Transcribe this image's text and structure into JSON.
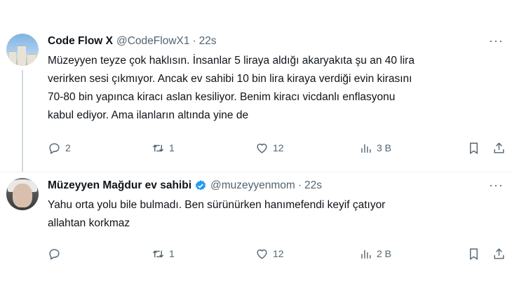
{
  "tweets": [
    {
      "name": "Code Flow X",
      "handle": "@CodeFlowX1",
      "separator": "·",
      "time": "22s",
      "more": "···",
      "body_lines": [
        "Müzeyyen teyze çok haklısın. İnsanlar 5 liraya aldığı akaryakıta şu an 40 lira",
        "verirken sesi çıkmıyor. Ancak ev sahibi 10 bin lira kiraya verdiği evin kirasını",
        "70-80 bin yapınca kiracı aslan kesiliyor.  Benim kiracı vicdanlı enflasyonu",
        "kabul ediyor. Ama ilanların altında yine de"
      ],
      "reply_count": "2",
      "retweet_count": "1",
      "like_count": "12",
      "view_count": "3 B",
      "verified": false
    },
    {
      "name": "Müzeyyen Mağdur ev sahibi",
      "handle": "@muzeyyenmom",
      "separator": "·",
      "time": "22s",
      "more": "···",
      "body_lines": [
        "Yahu orta yolu bile bulmadı. Ben sürünürken hanımefendi keyif çatıyor",
        "allahtan korkmaz"
      ],
      "reply_count": "",
      "retweet_count": "1",
      "like_count": "12",
      "view_count": "2 B",
      "verified": true
    }
  ],
  "colors": {
    "text": "#0f1419",
    "secondary": "#536471",
    "verified": "#1d9bf0",
    "divider": "#eff3f4"
  },
  "icons": [
    "reply-icon",
    "retweet-icon",
    "like-icon",
    "views-icon",
    "bookmark-icon",
    "share-icon",
    "more-icon",
    "verified-badge-icon"
  ]
}
